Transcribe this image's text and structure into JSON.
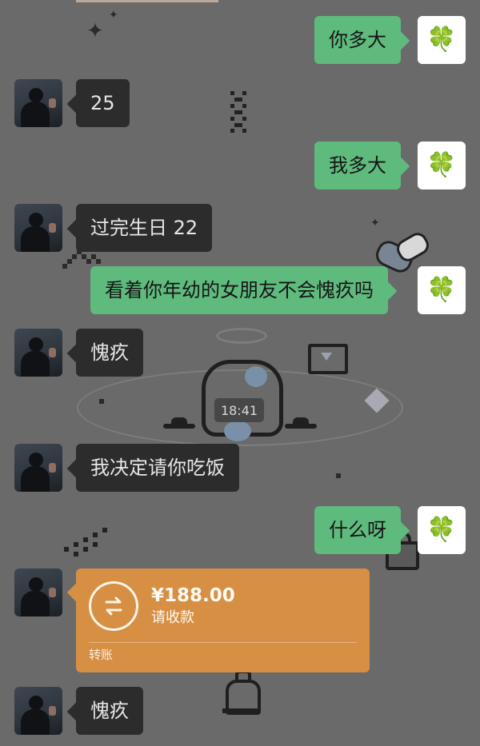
{
  "theme": {
    "background": "#6a6a6a",
    "left_bubble": "#2c2c2c",
    "right_bubble": "#5fba7d",
    "transfer_card": "#d68f43"
  },
  "time_divider": "18:41",
  "messages": [
    {
      "side": "right",
      "text": "你多大",
      "avatar": "clover-icon"
    },
    {
      "side": "left",
      "text": "25",
      "avatar": "user-avatar"
    },
    {
      "side": "right",
      "text": "我多大",
      "avatar": "clover-icon"
    },
    {
      "side": "left",
      "text": "过完生日 22",
      "avatar": "user-avatar"
    },
    {
      "side": "right",
      "text": "看着你年幼的女朋友不会愧疚吗",
      "avatar": "clover-icon"
    },
    {
      "side": "left",
      "text": "愧疚",
      "avatar": "user-avatar"
    },
    {
      "side": "left",
      "text": "我决定请你吃饭",
      "avatar": "user-avatar"
    },
    {
      "side": "right",
      "text": "什么呀",
      "avatar": "clover-icon"
    },
    {
      "side": "left",
      "text": "愧疚",
      "avatar": "user-avatar"
    }
  ],
  "transfer": {
    "amount": "¥188.00",
    "subtitle": "请收款",
    "label": "转账",
    "icon": "transfer-icon"
  }
}
